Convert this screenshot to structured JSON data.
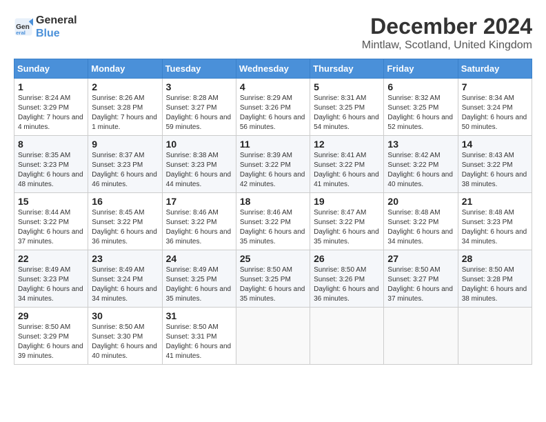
{
  "logo": {
    "line1": "General",
    "line2": "Blue"
  },
  "title": "December 2024",
  "subtitle": "Mintlaw, Scotland, United Kingdom",
  "days_of_week": [
    "Sunday",
    "Monday",
    "Tuesday",
    "Wednesday",
    "Thursday",
    "Friday",
    "Saturday"
  ],
  "weeks": [
    [
      {
        "day": "1",
        "sunrise": "8:24 AM",
        "sunset": "3:29 PM",
        "daylight": "7 hours and 4 minutes."
      },
      {
        "day": "2",
        "sunrise": "8:26 AM",
        "sunset": "3:28 PM",
        "daylight": "7 hours and 1 minute."
      },
      {
        "day": "3",
        "sunrise": "8:28 AM",
        "sunset": "3:27 PM",
        "daylight": "6 hours and 59 minutes."
      },
      {
        "day": "4",
        "sunrise": "8:29 AM",
        "sunset": "3:26 PM",
        "daylight": "6 hours and 56 minutes."
      },
      {
        "day": "5",
        "sunrise": "8:31 AM",
        "sunset": "3:25 PM",
        "daylight": "6 hours and 54 minutes."
      },
      {
        "day": "6",
        "sunrise": "8:32 AM",
        "sunset": "3:25 PM",
        "daylight": "6 hours and 52 minutes."
      },
      {
        "day": "7",
        "sunrise": "8:34 AM",
        "sunset": "3:24 PM",
        "daylight": "6 hours and 50 minutes."
      }
    ],
    [
      {
        "day": "8",
        "sunrise": "8:35 AM",
        "sunset": "3:23 PM",
        "daylight": "6 hours and 48 minutes."
      },
      {
        "day": "9",
        "sunrise": "8:37 AM",
        "sunset": "3:23 PM",
        "daylight": "6 hours and 46 minutes."
      },
      {
        "day": "10",
        "sunrise": "8:38 AM",
        "sunset": "3:23 PM",
        "daylight": "6 hours and 44 minutes."
      },
      {
        "day": "11",
        "sunrise": "8:39 AM",
        "sunset": "3:22 PM",
        "daylight": "6 hours and 42 minutes."
      },
      {
        "day": "12",
        "sunrise": "8:41 AM",
        "sunset": "3:22 PM",
        "daylight": "6 hours and 41 minutes."
      },
      {
        "day": "13",
        "sunrise": "8:42 AM",
        "sunset": "3:22 PM",
        "daylight": "6 hours and 40 minutes."
      },
      {
        "day": "14",
        "sunrise": "8:43 AM",
        "sunset": "3:22 PM",
        "daylight": "6 hours and 38 minutes."
      }
    ],
    [
      {
        "day": "15",
        "sunrise": "8:44 AM",
        "sunset": "3:22 PM",
        "daylight": "6 hours and 37 minutes."
      },
      {
        "day": "16",
        "sunrise": "8:45 AM",
        "sunset": "3:22 PM",
        "daylight": "6 hours and 36 minutes."
      },
      {
        "day": "17",
        "sunrise": "8:46 AM",
        "sunset": "3:22 PM",
        "daylight": "6 hours and 36 minutes."
      },
      {
        "day": "18",
        "sunrise": "8:46 AM",
        "sunset": "3:22 PM",
        "daylight": "6 hours and 35 minutes."
      },
      {
        "day": "19",
        "sunrise": "8:47 AM",
        "sunset": "3:22 PM",
        "daylight": "6 hours and 35 minutes."
      },
      {
        "day": "20",
        "sunrise": "8:48 AM",
        "sunset": "3:22 PM",
        "daylight": "6 hours and 34 minutes."
      },
      {
        "day": "21",
        "sunrise": "8:48 AM",
        "sunset": "3:23 PM",
        "daylight": "6 hours and 34 minutes."
      }
    ],
    [
      {
        "day": "22",
        "sunrise": "8:49 AM",
        "sunset": "3:23 PM",
        "daylight": "6 hours and 34 minutes."
      },
      {
        "day": "23",
        "sunrise": "8:49 AM",
        "sunset": "3:24 PM",
        "daylight": "6 hours and 34 minutes."
      },
      {
        "day": "24",
        "sunrise": "8:49 AM",
        "sunset": "3:25 PM",
        "daylight": "6 hours and 35 minutes."
      },
      {
        "day": "25",
        "sunrise": "8:50 AM",
        "sunset": "3:25 PM",
        "daylight": "6 hours and 35 minutes."
      },
      {
        "day": "26",
        "sunrise": "8:50 AM",
        "sunset": "3:26 PM",
        "daylight": "6 hours and 36 minutes."
      },
      {
        "day": "27",
        "sunrise": "8:50 AM",
        "sunset": "3:27 PM",
        "daylight": "6 hours and 37 minutes."
      },
      {
        "day": "28",
        "sunrise": "8:50 AM",
        "sunset": "3:28 PM",
        "daylight": "6 hours and 38 minutes."
      }
    ],
    [
      {
        "day": "29",
        "sunrise": "8:50 AM",
        "sunset": "3:29 PM",
        "daylight": "6 hours and 39 minutes."
      },
      {
        "day": "30",
        "sunrise": "8:50 AM",
        "sunset": "3:30 PM",
        "daylight": "6 hours and 40 minutes."
      },
      {
        "day": "31",
        "sunrise": "8:50 AM",
        "sunset": "3:31 PM",
        "daylight": "6 hours and 41 minutes."
      },
      null,
      null,
      null,
      null
    ]
  ],
  "labels": {
    "sunrise": "Sunrise:",
    "sunset": "Sunset:",
    "daylight": "Daylight:"
  }
}
